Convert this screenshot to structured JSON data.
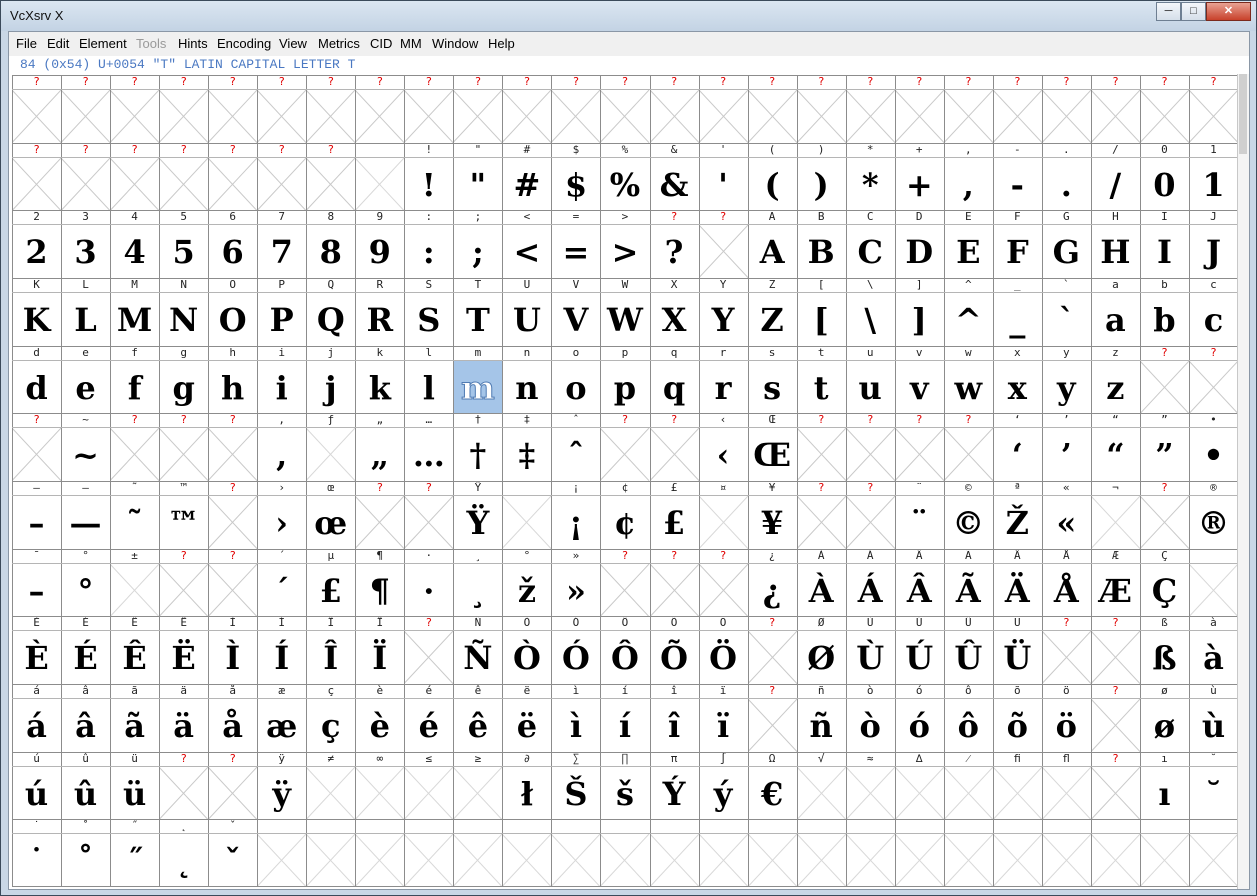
{
  "window": {
    "title": "VcXsrv X"
  },
  "menu": [
    {
      "label": "File",
      "disabled": false
    },
    {
      "label": "Edit",
      "disabled": false
    },
    {
      "label": "Element",
      "disabled": false
    },
    {
      "label": "Tools",
      "disabled": true
    },
    {
      "label": "Hints",
      "disabled": false
    },
    {
      "label": "Encoding",
      "disabled": false
    },
    {
      "label": "View",
      "disabled": false
    },
    {
      "label": "Metrics",
      "disabled": false
    },
    {
      "label": "CID",
      "disabled": false
    },
    {
      "label": "MM",
      "disabled": false
    },
    {
      "label": "Window",
      "disabled": false
    },
    {
      "label": "Help",
      "disabled": false
    }
  ],
  "info": "84 (0x54) U+0054 \"T\" LATIN CAPITAL LETTER T",
  "glyph_grid": {
    "columns": 25,
    "selected": [
      4,
      9
    ],
    "rows": [
      {
        "labels": [
          "?",
          "?",
          "?",
          "?",
          "?",
          "?",
          "?",
          "?",
          "?",
          "?",
          "?",
          "?",
          "?",
          "?",
          "?",
          "?",
          "?",
          "?",
          "?",
          "?",
          "?",
          "?",
          "?",
          "?",
          "?"
        ],
        "glyphs": [
          "",
          "",
          "",
          "",
          "",
          "",
          "",
          "",
          "",
          "",
          "",
          "",
          "",
          "",
          "",
          "",
          "",
          "",
          "",
          "",
          "",
          "",
          "",
          "",
          ""
        ]
      },
      {
        "labels": [
          "?",
          "?",
          "?",
          "?",
          "?",
          "?",
          "?",
          "",
          "!",
          "\"",
          "#",
          "$",
          "%",
          "&",
          "'",
          "(",
          ")",
          "*",
          "+",
          ",",
          "-",
          ".",
          "/",
          "0",
          "1"
        ],
        "glyphs": [
          "",
          "",
          "",
          "",
          "",
          "",
          "",
          "",
          "!",
          "\"",
          "#",
          "$",
          "%",
          "&",
          "'",
          "(",
          ")",
          "*",
          "+",
          ",",
          "-",
          ".",
          "/",
          "0",
          "1"
        ]
      },
      {
        "labels": [
          "2",
          "3",
          "4",
          "5",
          "6",
          "7",
          "8",
          "9",
          ":",
          ";",
          "<",
          "=",
          ">",
          "?",
          "?",
          "A",
          "B",
          "C",
          "D",
          "E",
          "F",
          "G",
          "H",
          "I",
          "J"
        ],
        "glyphs": [
          "2",
          "3",
          "4",
          "5",
          "6",
          "7",
          "8",
          "9",
          ":",
          ";",
          "<",
          "=",
          ">",
          "?",
          "",
          "A",
          "B",
          "C",
          "D",
          "E",
          "F",
          "G",
          "H",
          "I",
          "J"
        ]
      },
      {
        "labels": [
          "K",
          "L",
          "M",
          "N",
          "O",
          "P",
          "Q",
          "R",
          "S",
          "T",
          "U",
          "V",
          "W",
          "X",
          "Y",
          "Z",
          "[",
          "\\",
          "]",
          "^",
          "_",
          "`",
          "a",
          "b",
          "c"
        ],
        "glyphs": [
          "K",
          "L",
          "M",
          "N",
          "O",
          "P",
          "Q",
          "R",
          "S",
          "T",
          "U",
          "V",
          "W",
          "X",
          "Y",
          "Z",
          "[",
          "\\",
          "]",
          "^",
          "_",
          "`",
          "a",
          "b",
          "c"
        ]
      },
      {
        "labels": [
          "d",
          "e",
          "f",
          "g",
          "h",
          "i",
          "j",
          "k",
          "l",
          "m",
          "n",
          "o",
          "p",
          "q",
          "r",
          "s",
          "t",
          "u",
          "v",
          "w",
          "x",
          "y",
          "z",
          "?",
          "?"
        ],
        "glyphs": [
          "d",
          "e",
          "f",
          "g",
          "h",
          "i",
          "j",
          "k",
          "l",
          "m",
          "n",
          "o",
          "p",
          "q",
          "r",
          "s",
          "t",
          "u",
          "v",
          "w",
          "x",
          "y",
          "z",
          "",
          ""
        ]
      },
      {
        "labels": [
          "?",
          "~",
          "?",
          "?",
          "?",
          ",",
          "ƒ",
          "„",
          "…",
          "†",
          "‡",
          "ˆ",
          "?",
          "?",
          "‹",
          "Œ",
          "?",
          "?",
          "?",
          "?",
          "‘",
          "’",
          "“",
          "”",
          "•"
        ],
        "glyphs": [
          "",
          "~",
          "",
          "",
          "",
          ",",
          "",
          "„",
          "…",
          "†",
          "‡",
          "ˆ",
          "",
          "",
          "‹",
          "Œ",
          "",
          "",
          "",
          "",
          "‘",
          "’",
          "“",
          "”",
          "•"
        ]
      },
      {
        "labels": [
          "–",
          "—",
          "˜",
          "™",
          "?",
          "›",
          "œ",
          "?",
          "?",
          "Ÿ",
          "",
          "¡",
          "¢",
          "£",
          "¤",
          "¥",
          "?",
          "?",
          "¨",
          "©",
          "ª",
          "«",
          "¬",
          "?",
          "®"
        ],
        "glyphs": [
          "–",
          "—",
          "˜",
          "™",
          "",
          "›",
          "œ",
          "",
          "",
          "Ÿ",
          "",
          "¡",
          "¢",
          "£",
          "",
          "¥",
          "",
          "",
          "¨",
          "©",
          "Ž",
          "«",
          "",
          "",
          "®"
        ]
      },
      {
        "labels": [
          "¯",
          "°",
          "±",
          "?",
          "?",
          "´",
          "µ",
          "¶",
          "·",
          "¸",
          "°",
          "»",
          "?",
          "?",
          "?",
          "¿",
          "À",
          "Á",
          "Â",
          "Ã",
          "Ä",
          "Å",
          "Æ",
          "Ç",
          ""
        ],
        "glyphs": [
          "–",
          "°",
          "",
          "",
          "",
          "´",
          "£",
          "¶",
          "·",
          "¸",
          "ž",
          "»",
          "",
          "",
          "",
          "¿",
          "À",
          "Á",
          "Â",
          "Ã",
          "Ä",
          "Å",
          "Æ",
          "Ç",
          ""
        ]
      },
      {
        "labels": [
          "È",
          "É",
          "Ê",
          "Ë",
          "Ì",
          "Í",
          "Î",
          "Ï",
          "?",
          "Ñ",
          "Ò",
          "Ó",
          "Ô",
          "Õ",
          "Ö",
          "?",
          "Ø",
          "Ù",
          "Ú",
          "Û",
          "Ü",
          "?",
          "?",
          "ß",
          "à"
        ],
        "glyphs": [
          "È",
          "É",
          "Ê",
          "Ë",
          "Ì",
          "Í",
          "Î",
          "Ï",
          "",
          "Ñ",
          "Ò",
          "Ó",
          "Ô",
          "Õ",
          "Ö",
          "",
          "Ø",
          "Ù",
          "Ú",
          "Û",
          "Ü",
          "",
          "",
          "ß",
          "à"
        ]
      },
      {
        "labels": [
          "á",
          "â",
          "ã",
          "ä",
          "å",
          "æ",
          "ç",
          "è",
          "é",
          "ê",
          "ë",
          "ì",
          "í",
          "î",
          "ï",
          "?",
          "ñ",
          "ò",
          "ó",
          "ô",
          "õ",
          "ö",
          "?",
          "ø",
          "ù"
        ],
        "glyphs": [
          "á",
          "â",
          "ã",
          "ä",
          "å",
          "æ",
          "ç",
          "è",
          "é",
          "ê",
          "ë",
          "ì",
          "í",
          "î",
          "ï",
          "",
          "ñ",
          "ò",
          "ó",
          "ô",
          "õ",
          "ö",
          "",
          "ø",
          "ù"
        ]
      },
      {
        "labels": [
          "ú",
          "û",
          "ü",
          "?",
          "?",
          "ÿ",
          "≠",
          "∞",
          "≤",
          "≥",
          "∂",
          "∑",
          "∏",
          "π",
          "∫",
          "Ω",
          "√",
          "≈",
          "∆",
          "⁄",
          "ﬁ",
          "ﬂ",
          "?",
          "ı",
          "˘"
        ],
        "glyphs": [
          "ú",
          "û",
          "ü",
          "",
          "",
          "ÿ",
          "",
          "",
          "",
          "",
          "ł",
          "Š",
          "š",
          "Ý",
          "ý",
          "€",
          "",
          "",
          "",
          "",
          "",
          "",
          "",
          "ı",
          "˘"
        ]
      },
      {
        "labels": [
          "˙",
          "˚",
          "˝",
          "˛",
          "ˇ",
          "",
          "",
          "",
          "",
          "",
          "",
          "",
          "",
          "",
          "",
          "",
          "",
          "",
          "",
          "",
          "",
          "",
          "",
          "",
          ""
        ],
        "glyphs": [
          "˙",
          "˚",
          "˝",
          "˛",
          "ˇ",
          "",
          "",
          "",
          "",
          "",
          "",
          "",
          "",
          "",
          "",
          "",
          "",
          "",
          "",
          "",
          "",
          "",
          "",
          "",
          ""
        ]
      }
    ]
  }
}
